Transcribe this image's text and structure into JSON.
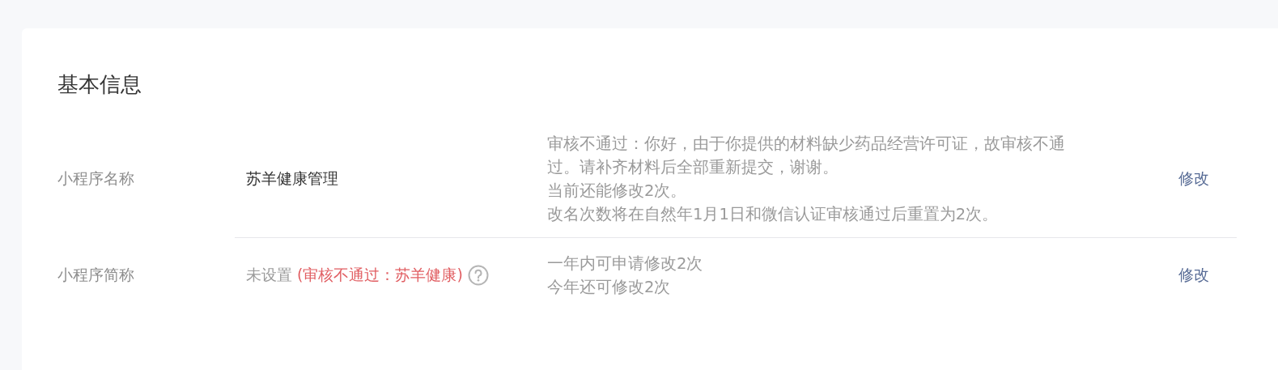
{
  "section_title": "基本信息",
  "rows": [
    {
      "label": "小程序名称",
      "value": "苏羊健康管理",
      "value_set": true,
      "notes": [
        "审核不通过：你好，由于你提供的材料缺少药品经营许可证，故审核不通过。请补齐材料后全部重新提交，谢谢。",
        "当前还能修改2次。",
        "改名次数将在自然年1月1日和微信认证审核通过后重置为2次。"
      ],
      "action": "修改"
    },
    {
      "label": "小程序简称",
      "value": "未设置",
      "value_set": false,
      "review_note": "(审核不通过：苏羊健康)",
      "help": true,
      "notes": [
        "一年内可申请修改2次",
        "今年还可修改2次"
      ],
      "action": "修改"
    }
  ]
}
